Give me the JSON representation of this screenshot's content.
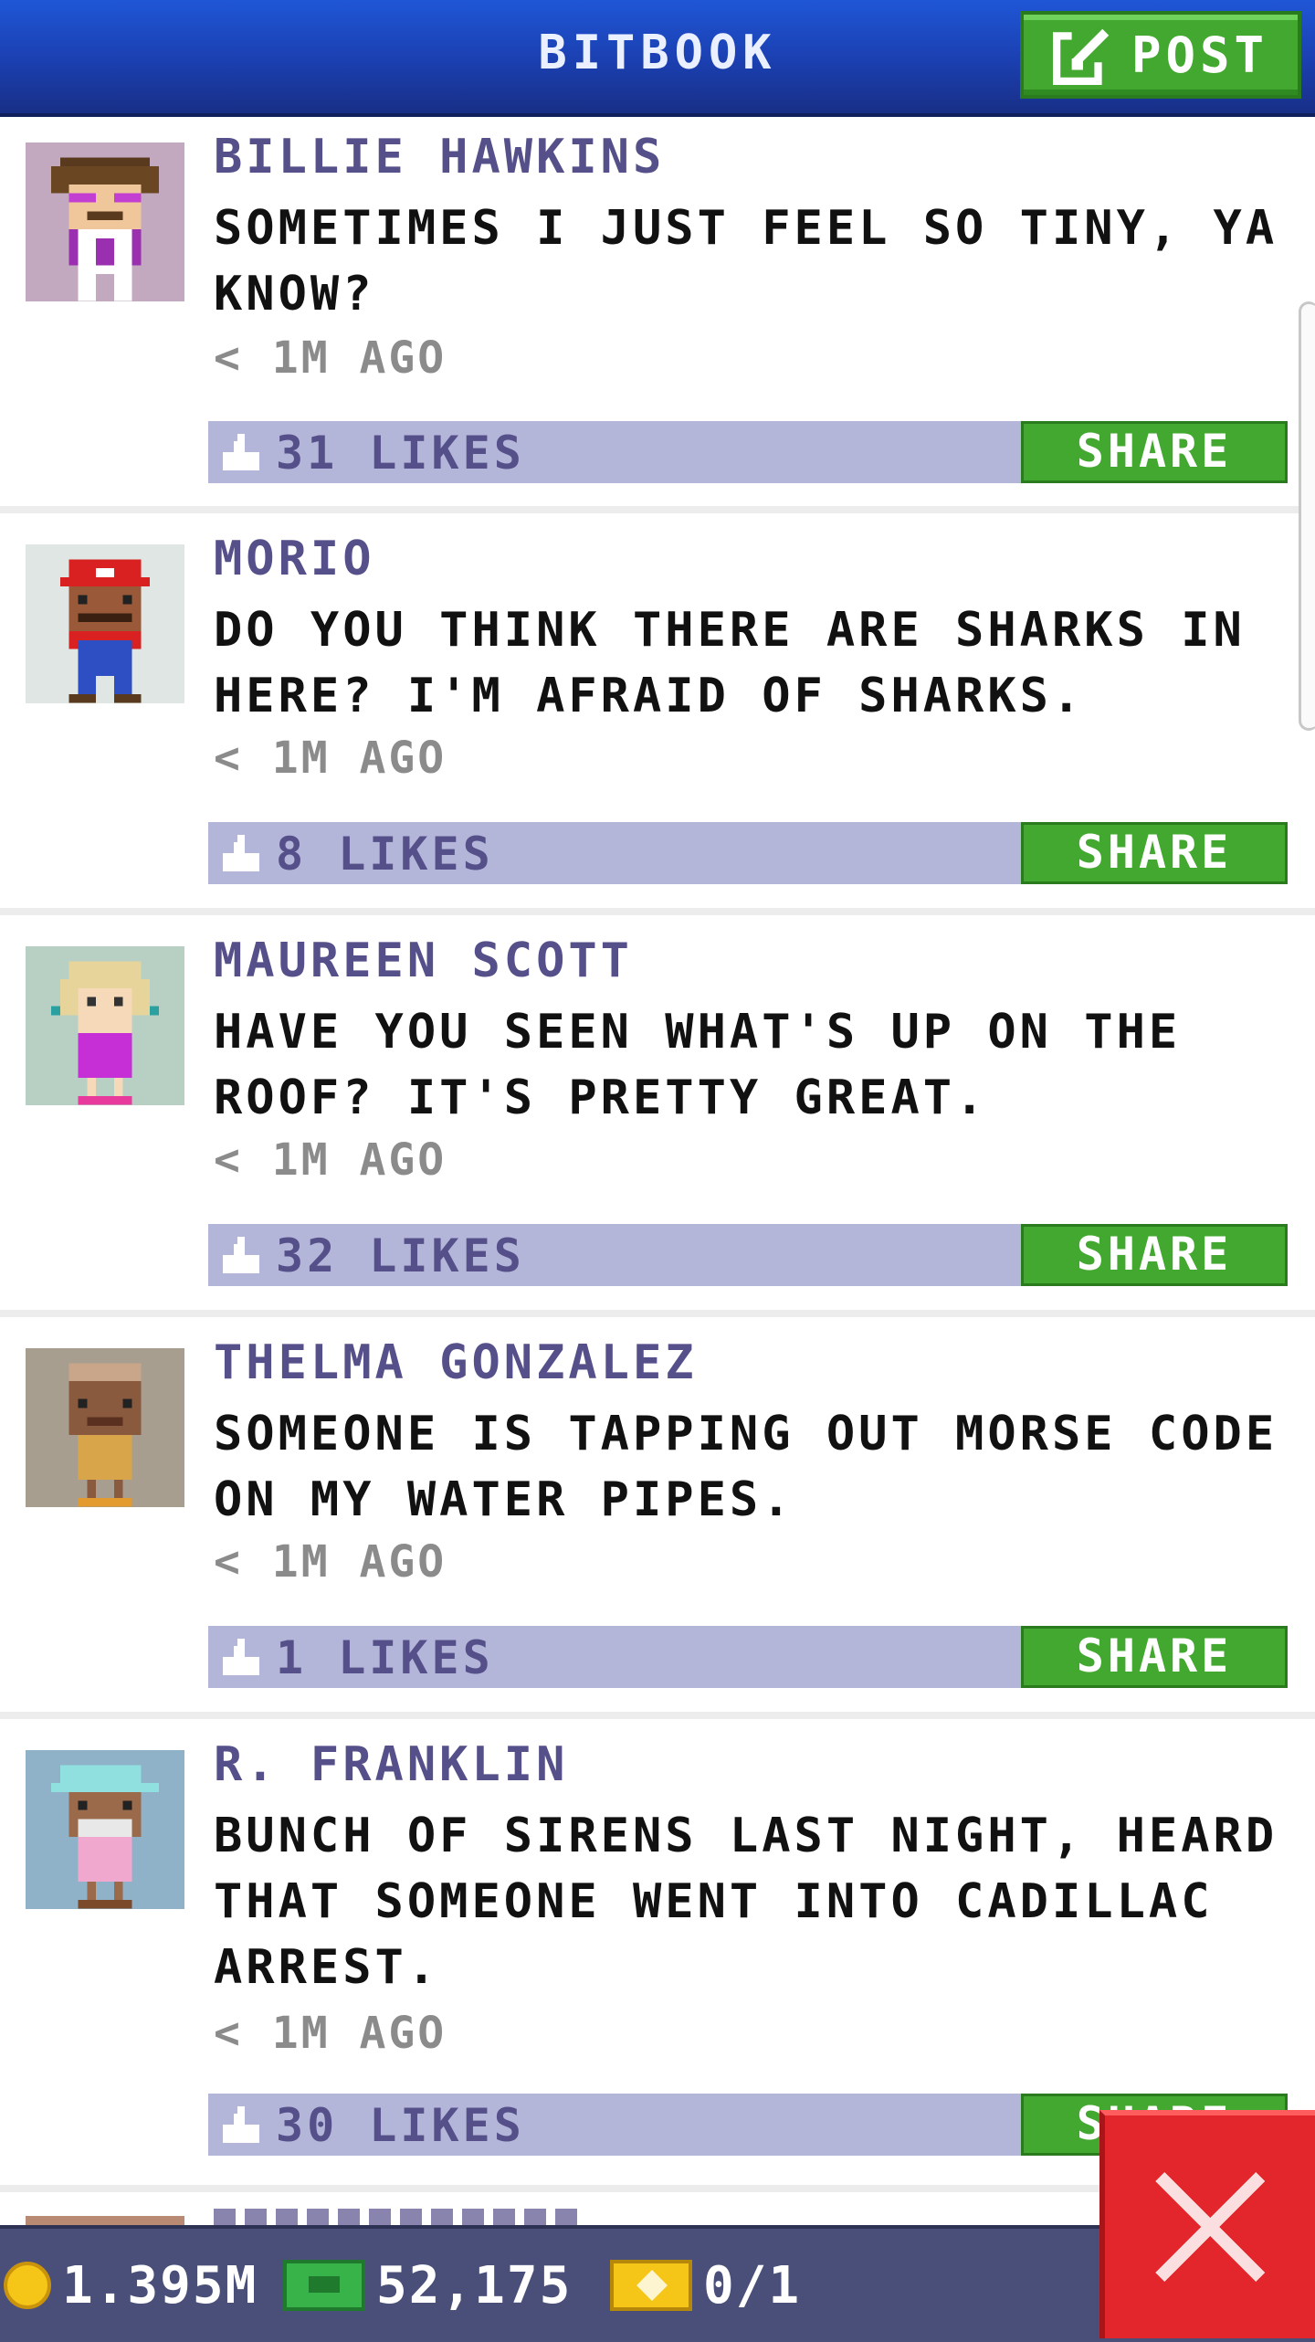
{
  "header": {
    "title": "BITBOOK",
    "post_label": "POST"
  },
  "posts": [
    {
      "name": "BILLIE HAWKINS",
      "message": "SOMETIMES I JUST FEEL SO TINY, YA KNOW?",
      "time": "< 1M AGO",
      "likes": "31 LIKES",
      "share": "SHARE"
    },
    {
      "name": "MORIO",
      "message": "DO YOU THINK THERE ARE SHARKS IN HERE? I'M AFRAID OF SHARKS.",
      "time": "< 1M AGO",
      "likes": "8 LIKES",
      "share": "SHARE"
    },
    {
      "name": "MAUREEN SCOTT",
      "message": "HAVE YOU SEEN WHAT'S UP ON THE ROOF? IT'S PRETTY GREAT.",
      "time": "< 1M AGO",
      "likes": "32 LIKES",
      "share": "SHARE"
    },
    {
      "name": "THELMA GONZALEZ",
      "message": "SOMEONE IS TAPPING OUT MORSE CODE ON MY WATER PIPES.",
      "time": "< 1M AGO",
      "likes": "1 LIKES",
      "share": "SHARE"
    },
    {
      "name": "R. FRANKLIN",
      "message": "BUNCH OF SIRENS LAST NIGHT, HEARD THAT SOMEONE WENT INTO CADILLAC ARREST.",
      "time": "< 1M AGO",
      "likes": "30 LIKES",
      "share": "SHARE"
    }
  ],
  "bottom_bar": {
    "coins": "1.395M",
    "bux": "52,175",
    "tickets": "0/1"
  },
  "colors": {
    "header": "#1b3fb0",
    "green": "#43a82f",
    "likes_bar": "#b3b6d8",
    "name": "#55508a",
    "close": "#e3262b"
  }
}
